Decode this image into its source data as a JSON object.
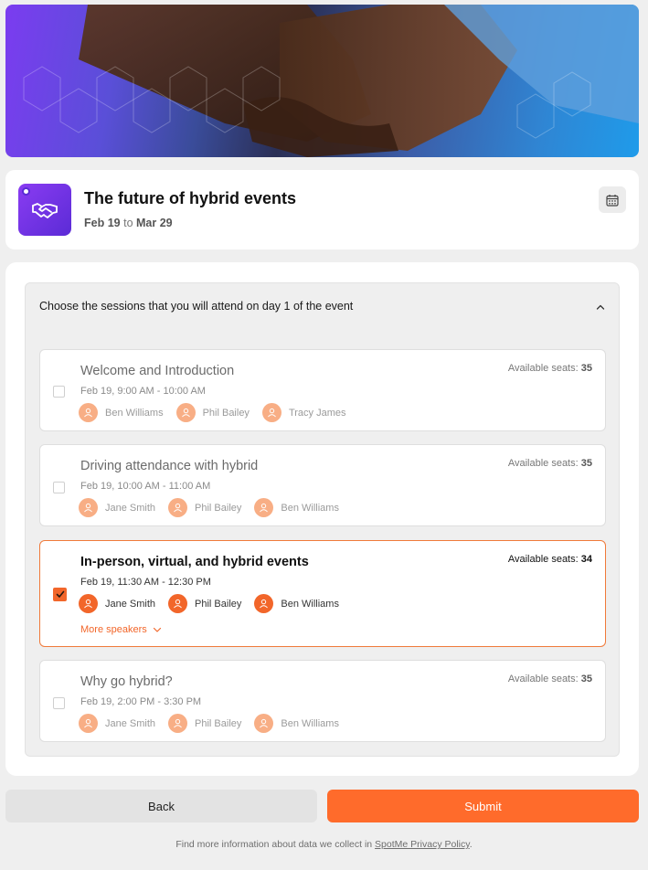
{
  "event": {
    "title": "The future of hybrid events",
    "date_start": "Feb 19",
    "date_to": "to",
    "date_end": "Mar 29"
  },
  "accordion": {
    "title": "Choose the sessions that you will attend on day 1 of the event"
  },
  "seats_label": "Available seats:",
  "sessions": [
    {
      "title": "Welcome and Introduction",
      "time": "Feb 19, 9:00 AM - 10:00 AM",
      "seats": "35",
      "selected": false,
      "speakers": [
        "Ben Williams",
        "Phil Bailey",
        "Tracy James"
      ]
    },
    {
      "title": "Driving attendance with hybrid",
      "time": "Feb 19, 10:00 AM - 11:00 AM",
      "seats": "35",
      "selected": false,
      "speakers": [
        "Jane Smith",
        "Phil Bailey",
        "Ben Williams"
      ]
    },
    {
      "title": "In-person, virtual, and hybrid events",
      "time": "Feb 19, 11:30 AM - 12:30 PM",
      "seats": "34",
      "selected": true,
      "speakers": [
        "Jane Smith",
        "Phil Bailey",
        "Ben Williams"
      ],
      "more_label": "More speakers"
    },
    {
      "title": "Why go hybrid?",
      "time": "Feb 19, 2:00 PM - 3:30 PM",
      "seats": "35",
      "selected": false,
      "speakers": [
        "Jane Smith",
        "Phil Bailey",
        "Ben Williams"
      ]
    }
  ],
  "buttons": {
    "back": "Back",
    "submit": "Submit"
  },
  "footer": {
    "text": "Find more information about data we collect in",
    "link": "SpotMe Privacy Policy",
    "end": "."
  },
  "colors": {
    "accent": "#ff6b2b",
    "logo": "#6a30e6"
  },
  "icons": {
    "logo": "handshake-icon",
    "calendar": "calendar-icon",
    "chevron": "chevron-up-icon",
    "avatar": "user-icon",
    "check": "checkmark-icon"
  }
}
